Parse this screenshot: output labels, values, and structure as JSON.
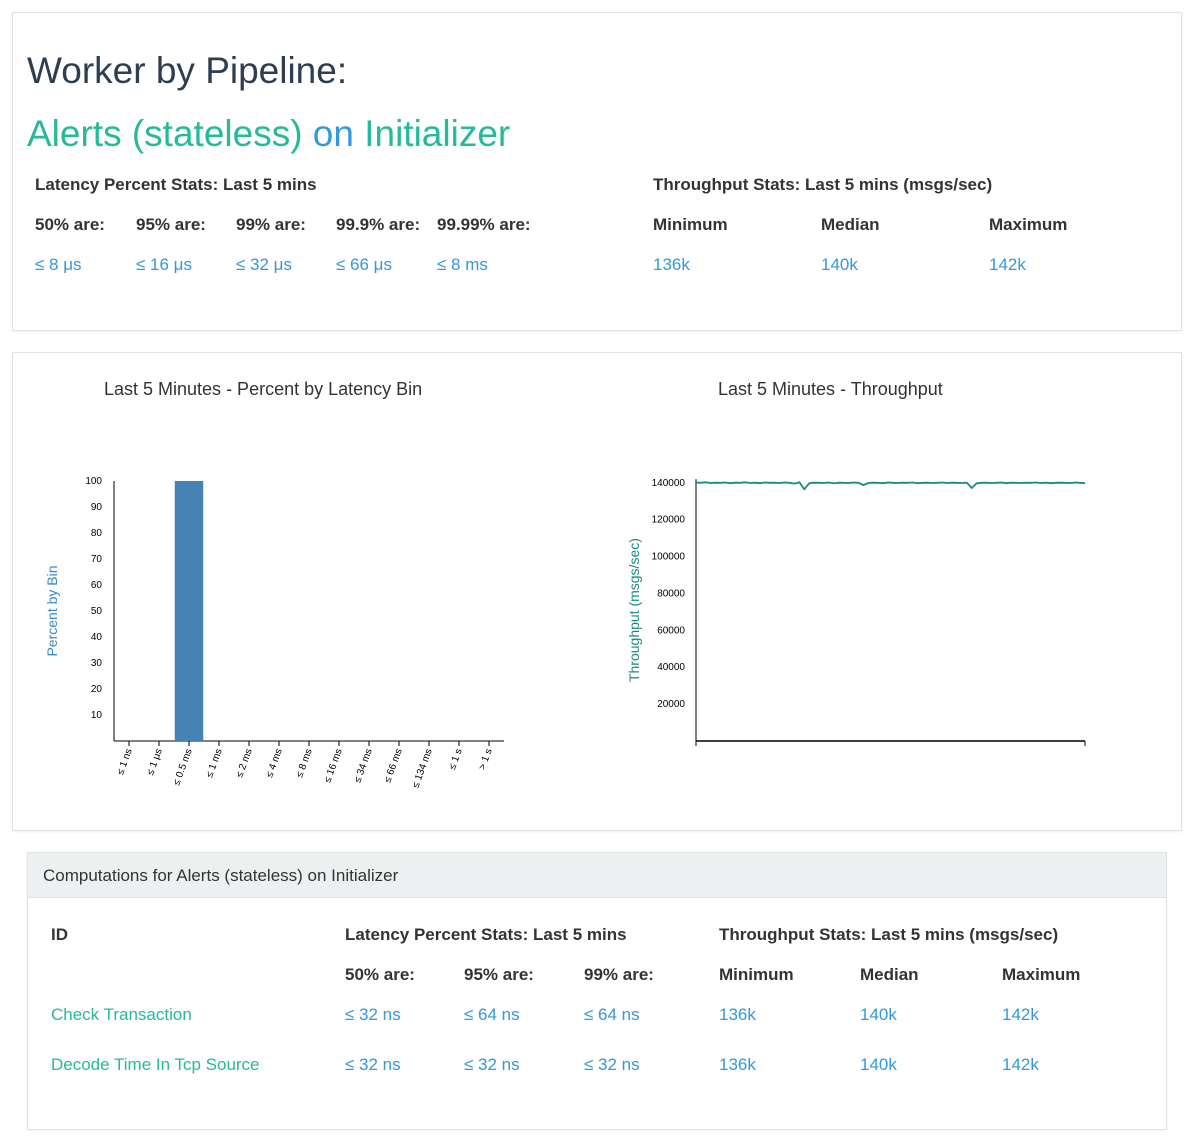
{
  "header": {
    "title": "Worker by Pipeline:",
    "pipeline": "Alerts (stateless)",
    "on": "on",
    "worker": "Initializer"
  },
  "summary": {
    "latency_title": "Latency Percent Stats: Last 5 mins",
    "latency_headers": [
      "50% are:",
      "95% are:",
      "99% are:",
      "99.9% are:",
      "99.99% are:"
    ],
    "latency_values": [
      "≤ 8 μs",
      "≤ 16 μs",
      "≤ 32 μs",
      "≤ 66 μs",
      "≤ 8 ms"
    ],
    "throughput_title": "Throughput Stats: Last 5 mins (msgs/sec)",
    "throughput_headers": [
      "Minimum",
      "Median",
      "Maximum"
    ],
    "throughput_values": [
      "136k",
      "140k",
      "142k"
    ]
  },
  "latency_chart": {
    "title": "Last 5 Minutes - Percent by Latency Bin",
    "chart_data": {
      "type": "bar",
      "ylabel": "Percent by Bin",
      "ylim": [
        0,
        100
      ],
      "yticks": [
        10,
        20,
        30,
        40,
        50,
        60,
        70,
        80,
        90,
        100
      ],
      "categories": [
        "≤ 1 ns",
        "≤ 1 μs",
        "≤ 0.5 ms",
        "≤ 1 ms",
        "≤ 2 ms",
        "≤ 4 ms",
        "≤ 8 ms",
        "≤ 16 ms",
        "≤ 34 ms",
        "≤ 66 ms",
        "≤ 134 ms",
        "≤ 1 s",
        "> 1 s"
      ],
      "values": [
        0,
        0,
        100,
        0,
        0,
        0,
        0,
        0,
        0,
        0,
        0,
        0,
        0
      ],
      "color": "#4682b4"
    }
  },
  "throughput_chart": {
    "title": "Last 5 Minutes - Throughput",
    "chart_data": {
      "type": "line",
      "ylabel": "Throughput (msgs/sec)",
      "ylim": [
        0,
        142000
      ],
      "yticks": [
        20000,
        40000,
        60000,
        80000,
        100000,
        120000,
        140000
      ],
      "values": [
        140200,
        140000,
        140300,
        139900,
        140100,
        140000,
        140200,
        139800,
        140100,
        140000,
        140300,
        139900,
        140100,
        139800,
        140200,
        140000,
        140100,
        139900,
        140200,
        140000,
        139600,
        140300,
        136500,
        139800,
        140100,
        140000,
        139900,
        140200,
        139700,
        140100,
        140000,
        139900,
        140200,
        140000,
        138800,
        139900,
        140100,
        140000,
        139800,
        140200,
        140000,
        139900,
        140100,
        140000,
        140200,
        139800,
        140000,
        140100,
        139900,
        140000,
        140200,
        139900,
        140100,
        140000,
        139900,
        140100,
        137200,
        139800,
        140000,
        140100,
        139900,
        140000,
        140200,
        139800,
        140100,
        140000,
        139900,
        140100,
        140000,
        140200,
        139900,
        140100,
        139800,
        140000,
        140100,
        140000,
        139900,
        140200,
        140000,
        139800
      ],
      "color": "#1a8a80"
    }
  },
  "computations": {
    "title": "Computations for Alerts (stateless) on Initializer",
    "id_header": "ID",
    "latency_title": "Latency Percent Stats: Last 5 mins",
    "latency_headers": [
      "50% are:",
      "95% are:",
      "99% are:"
    ],
    "throughput_title": "Throughput Stats: Last 5 mins (msgs/sec)",
    "throughput_headers": [
      "Minimum",
      "Median",
      "Maximum"
    ],
    "rows": [
      {
        "id": "Check Transaction",
        "latency": [
          "≤ 32 ns",
          "≤ 64 ns",
          "≤ 64 ns"
        ],
        "throughput": [
          "136k",
          "140k",
          "142k"
        ]
      },
      {
        "id": "Decode Time In Tcp Source",
        "latency": [
          "≤ 32 ns",
          "≤ 32 ns",
          "≤ 32 ns"
        ],
        "throughput": [
          "136k",
          "140k",
          "142k"
        ]
      }
    ]
  }
}
